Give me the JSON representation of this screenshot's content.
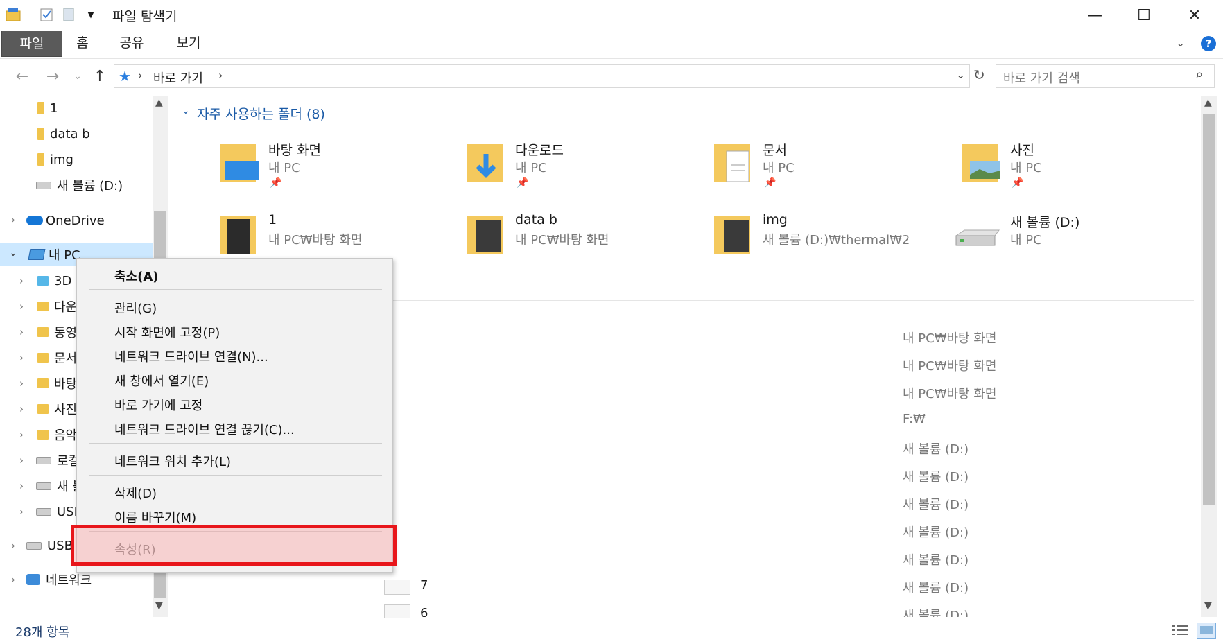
{
  "window": {
    "title": "파일 탐색기",
    "minimize": "—",
    "maximize": "☐",
    "close": "✕"
  },
  "ribbon": {
    "tabs": [
      "파일",
      "홈",
      "공유",
      "보기"
    ],
    "help": "?"
  },
  "address": {
    "path_root": "바로 가기",
    "search_placeholder": "바로 가기 검색"
  },
  "nav": {
    "items": [
      {
        "label": "1"
      },
      {
        "label": "data b"
      },
      {
        "label": "img"
      },
      {
        "label": "새 볼륨 (D:)"
      },
      {
        "label": "OneDrive"
      },
      {
        "label": "내 PC"
      },
      {
        "label": "3D"
      },
      {
        "label": "다운"
      },
      {
        "label": "동영"
      },
      {
        "label": "문서"
      },
      {
        "label": "바탕"
      },
      {
        "label": "사진"
      },
      {
        "label": "음악"
      },
      {
        "label": "로컬"
      },
      {
        "label": "새 볼"
      },
      {
        "label": "USB"
      },
      {
        "label": "USB"
      },
      {
        "label": "네트워크"
      }
    ]
  },
  "main": {
    "frequent_title": "자주 사용하는 폴더 (8)",
    "folders": [
      {
        "name": "바탕 화면",
        "location": "내 PC",
        "pinned": true
      },
      {
        "name": "다운로드",
        "location": "내 PC",
        "pinned": true
      },
      {
        "name": "문서",
        "location": "내 PC",
        "pinned": true
      },
      {
        "name": "사진",
        "location": "내 PC",
        "pinned": true
      },
      {
        "name": "1",
        "location": "내 PC₩바탕 화면",
        "pinned": false
      },
      {
        "name": "data b",
        "location": "내 PC₩바탕 화면",
        "pinned": false
      },
      {
        "name": "img",
        "location": "새 볼륨 (D:)₩thermal₩2",
        "pinned": false
      },
      {
        "name": "새 볼륨 (D:)",
        "location": "내 PC",
        "pinned": false
      }
    ],
    "recent_paths": [
      "내 PC₩바탕 화면",
      "내 PC₩바탕 화면",
      "내 PC₩바탕 화면",
      "F:₩",
      "새 볼륨 (D:)",
      "새 볼륨 (D:)",
      "새 볼륨 (D:)",
      "새 볼륨 (D:)",
      "새 볼륨 (D:)",
      "새 볼륨 (D:)",
      "새 볼륨 (D:)"
    ],
    "recent_names": [
      "7",
      "6"
    ]
  },
  "context_menu": {
    "items": [
      "축소(A)",
      "관리(G)",
      "시작 화면에 고정(P)",
      "네트워크 드라이브 연결(N)...",
      "새 창에서 열기(E)",
      "바로 가기에 고정",
      "네트워크 드라이브 연결 끊기(C)...",
      "네트워크 위치 추가(L)",
      "삭제(D)",
      "이름 바꾸기(M)",
      "속성(R)"
    ]
  },
  "status": {
    "count": "28개 항목"
  },
  "colors": {
    "accent": "#1a5aa6",
    "highlight": "#e8161b",
    "folder": "#f0c44c"
  }
}
